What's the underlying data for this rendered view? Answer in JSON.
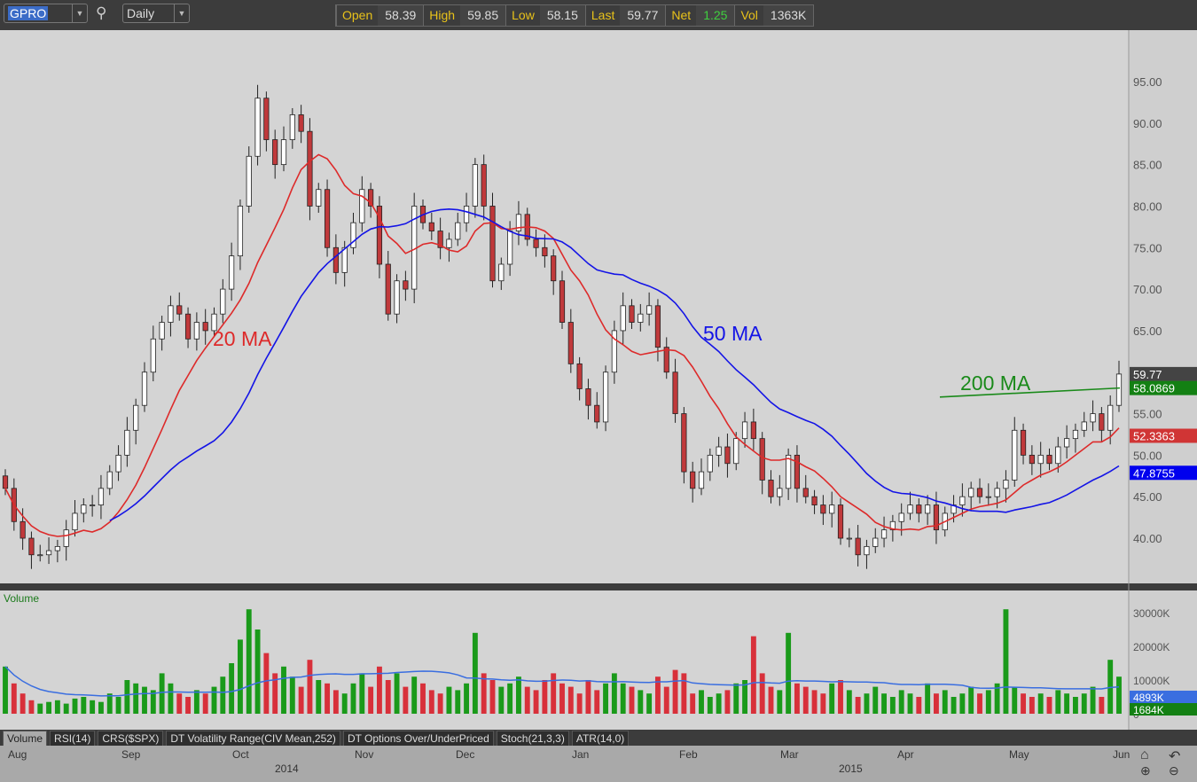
{
  "toolbar": {
    "symbol": "GPRO",
    "interval": "Daily",
    "quote": [
      {
        "label": "Open",
        "value": "58.39"
      },
      {
        "label": "High",
        "value": "59.85"
      },
      {
        "label": "Low",
        "value": "58.15"
      },
      {
        "label": "Last",
        "value": "59.77"
      },
      {
        "label": "Net",
        "value": "1.25"
      },
      {
        "label": "Vol",
        "value": "1363K"
      }
    ]
  },
  "tabs": [
    "Volume",
    "RSI(14)",
    "CRS($SPX)",
    "DT Volatility Range(CIV Mean,252)",
    "DT Options Over/UnderPriced",
    "Stoch(21,3,3)",
    "ATR(14,0)"
  ],
  "x_axis": {
    "months": [
      "Aug",
      "Sep",
      "Oct",
      "Nov",
      "Dec",
      "Jan",
      "Feb",
      "Mar",
      "Apr",
      "May",
      "Jun"
    ],
    "years": [
      "2014",
      "2015"
    ]
  },
  "colors": {
    "up": "#ffffff",
    "down": "#c0393b",
    "ma20": "#dd2a2a",
    "ma50": "#1414e6",
    "ma200": "#1a8a1a",
    "vol_up": "#1a9a1a",
    "vol_down": "#d8303a"
  },
  "chart_data": {
    "type": "candlestick",
    "symbol": "GPRO",
    "y_ticks": [
      "95.00",
      "90.00",
      "85.00",
      "80.00",
      "75.00",
      "70.00",
      "65.00",
      "60.00",
      "55.00",
      "50.00",
      "45.00",
      "40.00"
    ],
    "ylim": [
      35,
      100
    ],
    "closes": [
      46,
      42,
      40,
      38,
      38,
      38.5,
      39,
      41,
      43,
      44,
      44,
      46,
      48,
      50,
      53,
      56,
      60,
      64,
      66,
      68,
      67,
      64,
      66,
      65,
      67,
      70,
      74,
      80,
      86,
      93,
      88,
      85,
      88,
      91,
      89,
      80,
      82,
      75,
      72,
      75,
      78,
      82,
      80,
      73,
      67,
      71,
      70,
      80,
      78,
      77,
      75,
      76,
      78,
      80,
      85,
      80,
      71,
      73,
      77,
      79,
      76,
      75,
      74,
      71,
      66,
      61,
      58,
      56,
      54,
      60,
      65,
      68,
      66,
      67,
      68,
      63,
      60,
      55,
      48,
      46,
      48,
      50,
      51,
      49,
      52,
      54,
      52,
      47,
      45,
      46,
      50,
      46,
      45,
      44,
      43,
      44,
      40,
      40,
      38,
      39,
      40,
      41,
      42,
      43,
      44,
      43,
      44,
      41,
      43,
      44,
      45,
      46,
      45,
      45,
      46,
      47,
      53,
      50,
      49,
      50,
      49,
      51,
      52,
      53,
      54,
      55,
      53,
      56,
      59.77
    ],
    "volume_k": [
      14000,
      9000,
      6000,
      4000,
      3000,
      3500,
      4000,
      3000,
      4500,
      5000,
      4000,
      3500,
      6000,
      5000,
      10000,
      9000,
      8000,
      7000,
      12000,
      9000,
      6000,
      5000,
      7000,
      6000,
      8000,
      11000,
      15000,
      22000,
      31000,
      25000,
      18000,
      12000,
      14000,
      11000,
      8000,
      16000,
      10000,
      9000,
      7000,
      6000,
      9000,
      12000,
      8000,
      14000,
      10000,
      12000,
      8000,
      11000,
      9000,
      7000,
      6000,
      8000,
      7000,
      9000,
      24000,
      12000,
      10000,
      8000,
      9000,
      11000,
      8000,
      7000,
      10000,
      12000,
      9000,
      8000,
      6000,
      10000,
      7000,
      9000,
      12000,
      9000,
      8000,
      7000,
      6000,
      11000,
      8000,
      13000,
      12000,
      6000,
      7000,
      5000,
      6000,
      7000,
      9000,
      10000,
      23000,
      12000,
      8000,
      7000,
      24000,
      9000,
      8000,
      7000,
      6000,
      9000,
      10000,
      7000,
      5000,
      6000,
      8000,
      6000,
      5000,
      7000,
      6000,
      5000,
      9000,
      6000,
      7000,
      5000,
      6000,
      8000,
      6000,
      7000,
      9000,
      31000,
      8000,
      6000,
      5000,
      6000,
      5000,
      7000,
      6000,
      5000,
      6000,
      8000,
      5000,
      16000,
      11000
    ],
    "volume_ticks": [
      "30000K",
      "20000K",
      "10000K",
      "0"
    ],
    "labels": {
      "ma20": "20 MA",
      "ma50": "50 MA",
      "ma200": "200 MA",
      "volume": "Volume"
    },
    "last_values": {
      "last": "59.77",
      "ma200": "58.0869",
      "ma20": "52.3363",
      "ma50": "47.8755",
      "vol_avg": "4893K",
      "vol_last": "1684K"
    },
    "ma200_line": [
      57.0,
      58.09
    ],
    "ma_periods_in_bars": [
      10,
      25
    ]
  }
}
